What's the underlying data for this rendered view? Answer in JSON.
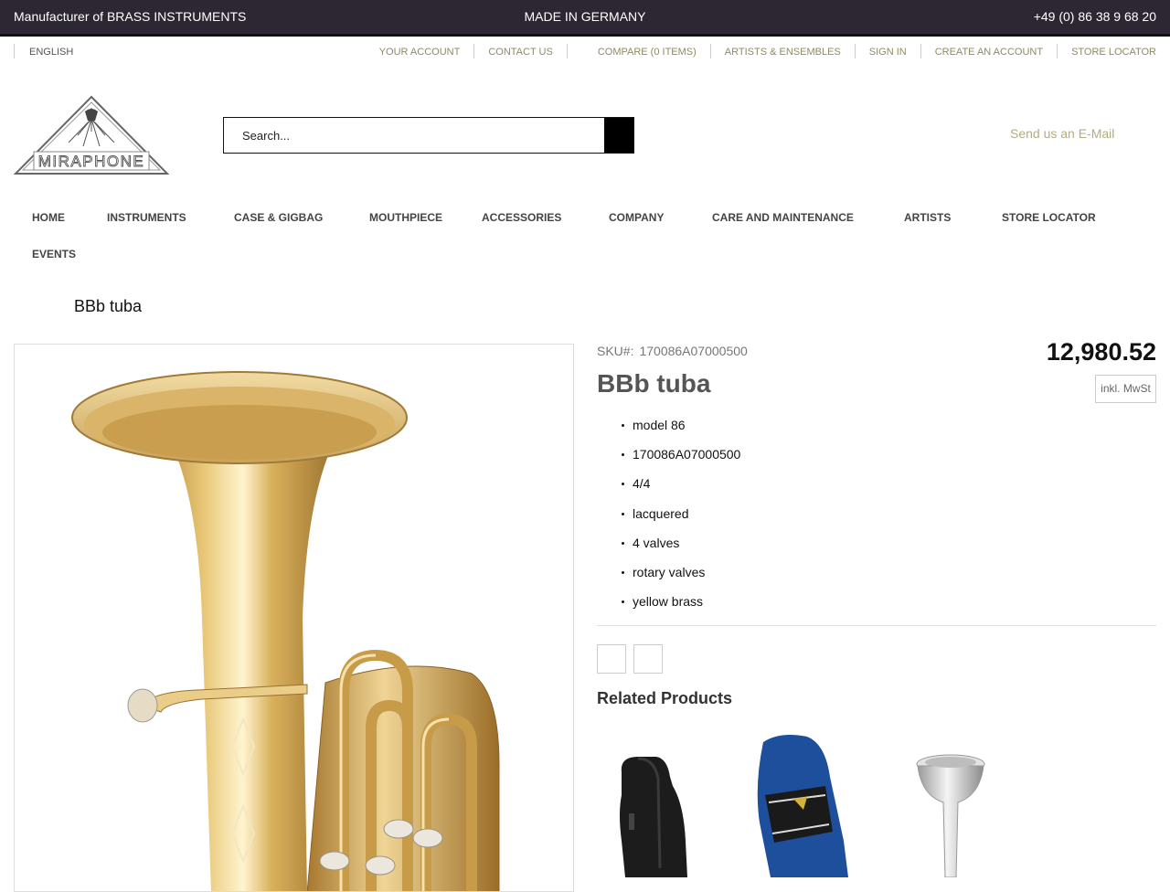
{
  "topbar": {
    "left": "Manufacturer of BRASS INSTRUMENTS",
    "center": "MADE IN GERMANY",
    "phone": "+49 (0) 86 38 9 68 20"
  },
  "util": {
    "language": "ENGLISH",
    "links": {
      "account": "YOUR ACCOUNT",
      "contact": "CONTACT US",
      "compare": "COMPARE (0 ITEMS)",
      "artists": "ARTISTS & ENSEMBLES",
      "sign_in": "SIGN IN",
      "create": "CREATE AN ACCOUNT",
      "store": "STORE LOCATOR"
    }
  },
  "logo": {
    "text": "MIRAPHONE"
  },
  "search": {
    "placeholder": "Search..."
  },
  "header": {
    "email": "Send us an E-Mail"
  },
  "nav": {
    "home": "HOME",
    "instruments": "INSTRUMENTS",
    "case": "CASE & GIGBAG",
    "mouthpiece": "MOUTHPIECE",
    "accessories": "ACCESSORIES",
    "company": "COMPANY",
    "care": "CARE AND MAINTENANCE",
    "artists": "ARTISTS",
    "store": "STORE LOCATOR",
    "events": "EVENTS"
  },
  "breadcrumb_title": "BBb tuba",
  "product": {
    "sku_label": "SKU#:",
    "sku": "170086A07000500",
    "title": "BBb tuba",
    "price": "12,980.52",
    "vat": "inkl. MwSt",
    "features": [
      "model 86",
      "170086A07000500",
      "4/4",
      "lacquered",
      "4 valves",
      "rotary valves",
      "yellow brass"
    ]
  },
  "related": {
    "heading": "Related Products"
  },
  "colors": {
    "topbar": "#2c2733",
    "accent": "#8e8b62",
    "email": "#b3ad82",
    "brass": "#d9b15c"
  }
}
